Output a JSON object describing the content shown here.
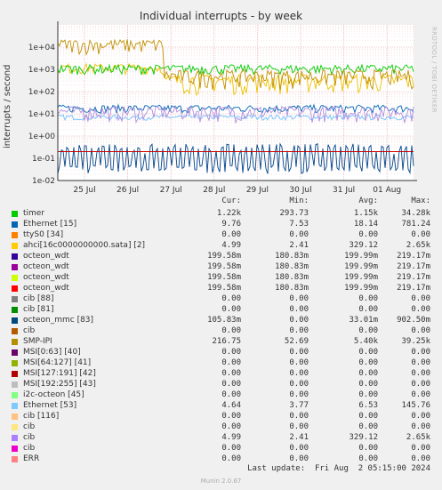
{
  "title": "Individual interrupts - by week",
  "side_label": "RRDTOOL / TOBI OETIKER",
  "chart_data": {
    "type": "line",
    "title": "Individual interrupts - by week",
    "ylabel": "interrupts / second",
    "yscale": "log",
    "ylim": [
      0.01,
      100000
    ],
    "y_ticks": [
      "1e+04",
      "1e+03",
      "1e+02",
      "1e+01",
      "1e+00",
      "1e-01",
      "1e-02"
    ],
    "x_ticks": [
      "25 Jul",
      "26 Jul",
      "27 Jul",
      "28 Jul",
      "29 Jul",
      "30 Jul",
      "31 Jul",
      "01 Aug"
    ],
    "grid": true,
    "series_summary": [
      {
        "name": "SMP-IPI",
        "color": "#c09000",
        "approx_level": 5400
      },
      {
        "name": "timer",
        "color": "#00cc00",
        "approx_level": 1150
      },
      {
        "name": "ahci[16c0000000000.sata] [2]",
        "color": "#eec000",
        "approx_level": 329
      },
      {
        "name": "cib",
        "color": "#b28de0",
        "approx_level": 10
      },
      {
        "name": "Ethernet [15]",
        "color": "#0066b3",
        "approx_level": 18
      },
      {
        "name": "Ethernet [53]",
        "color": "#6ec0ff",
        "approx_level": 6.5
      },
      {
        "name": "octeon_mmc [83]",
        "color": "#00468c",
        "approx_level": 0.033
      },
      {
        "name": "cib",
        "color": "#cc0000",
        "approx_level": 0.2
      }
    ]
  },
  "legend": {
    "headers": {
      "cur": "Cur:",
      "min": "Min:",
      "avg": "Avg:",
      "max": "Max:"
    },
    "rows": [
      {
        "name": "timer",
        "color": "#00cc00",
        "cur": "1.22k",
        "min": "293.73",
        "avg": "1.15k",
        "max": "34.28k"
      },
      {
        "name": "Ethernet [15]",
        "color": "#0066b3",
        "cur": "9.76",
        "min": "7.53",
        "avg": "18.14",
        "max": "781.24"
      },
      {
        "name": "ttyS0 [34]",
        "color": "#ff8000",
        "cur": "0.00",
        "min": "0.00",
        "avg": "0.00",
        "max": "0.00"
      },
      {
        "name": "ahci[16c0000000000.sata] [2]",
        "color": "#ffcc00",
        "cur": "4.99",
        "min": "2.41",
        "avg": "329.12",
        "max": "2.65k"
      },
      {
        "name": "octeon_wdt",
        "color": "#330099",
        "cur": "199.58m",
        "min": "180.83m",
        "avg": "199.99m",
        "max": "219.17m"
      },
      {
        "name": "octeon_wdt",
        "color": "#990099",
        "cur": "199.58m",
        "min": "180.83m",
        "avg": "199.99m",
        "max": "219.17m"
      },
      {
        "name": "octeon_wdt",
        "color": "#ccff00",
        "cur": "199.58m",
        "min": "180.83m",
        "avg": "199.99m",
        "max": "219.17m"
      },
      {
        "name": "octeon_wdt",
        "color": "#ff0000",
        "cur": "199.58m",
        "min": "180.83m",
        "avg": "199.99m",
        "max": "219.17m"
      },
      {
        "name": "cib [88]",
        "color": "#808080",
        "cur": "0.00",
        "min": "0.00",
        "avg": "0.00",
        "max": "0.00"
      },
      {
        "name": "cib [81]",
        "color": "#008f00",
        "cur": "0.00",
        "min": "0.00",
        "avg": "0.00",
        "max": "0.00"
      },
      {
        "name": "octeon_mmc [83]",
        "color": "#00487d",
        "cur": "105.83m",
        "min": "0.00",
        "avg": "33.01m",
        "max": "902.50m"
      },
      {
        "name": "cib",
        "color": "#b35a00",
        "cur": "0.00",
        "min": "0.00",
        "avg": "0.00",
        "max": "0.00"
      },
      {
        "name": "SMP-IPI",
        "color": "#b38f00",
        "cur": "216.75",
        "min": "52.69",
        "avg": "5.40k",
        "max": "39.25k"
      },
      {
        "name": "MSI[0:63] [40]",
        "color": "#6b006b",
        "cur": "0.00",
        "min": "0.00",
        "avg": "0.00",
        "max": "0.00"
      },
      {
        "name": "MSI[64:127] [41]",
        "color": "#8fb300",
        "cur": "0.00",
        "min": "0.00",
        "avg": "0.00",
        "max": "0.00"
      },
      {
        "name": "MSI[127:191] [42]",
        "color": "#b30000",
        "cur": "0.00",
        "min": "0.00",
        "avg": "0.00",
        "max": "0.00"
      },
      {
        "name": "MSI[192:255] [43]",
        "color": "#bebebe",
        "cur": "0.00",
        "min": "0.00",
        "avg": "0.00",
        "max": "0.00"
      },
      {
        "name": "i2c-octeon [45]",
        "color": "#80ff80",
        "cur": "0.00",
        "min": "0.00",
        "avg": "0.00",
        "max": "0.00"
      },
      {
        "name": "Ethernet [53]",
        "color": "#80c9ff",
        "cur": "4.64",
        "min": "3.77",
        "avg": "6.53",
        "max": "145.76"
      },
      {
        "name": "cib [116]",
        "color": "#ffc080",
        "cur": "0.00",
        "min": "0.00",
        "avg": "0.00",
        "max": "0.00"
      },
      {
        "name": "cib",
        "color": "#ffe680",
        "cur": "0.00",
        "min": "0.00",
        "avg": "0.00",
        "max": "0.00"
      },
      {
        "name": "cib",
        "color": "#aa80ff",
        "cur": "4.99",
        "min": "2.41",
        "avg": "329.12",
        "max": "2.65k"
      },
      {
        "name": "cib",
        "color": "#ee00cc",
        "cur": "0.00",
        "min": "0.00",
        "avg": "0.00",
        "max": "0.00"
      },
      {
        "name": "ERR",
        "color": "#ff8080",
        "cur": "0.00",
        "min": "0.00",
        "avg": "0.00",
        "max": "0.00"
      }
    ]
  },
  "last_update": "Last update:  Fri Aug  2 05:15:00 2024",
  "munin_version": "Munin 2.0.67"
}
